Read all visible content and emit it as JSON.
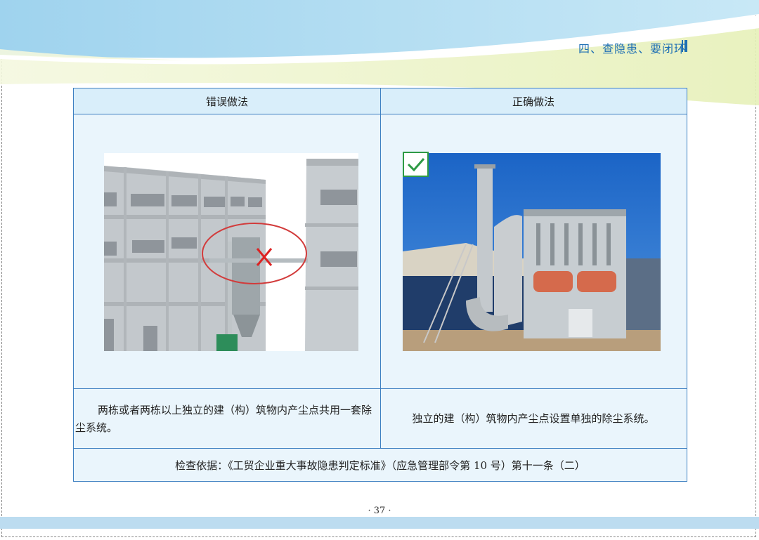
{
  "header": {
    "title": "四、查隐患、要闭环"
  },
  "table": {
    "col_wrong": "错误做法",
    "col_right": "正确做法",
    "wrong_desc": "两栋或者两栋以上独立的建（构）筑物内产尘点共用一套除尘系统。",
    "right_desc": "独立的建（构）筑物内产尘点设置单独的除尘系统。",
    "basis": "检查依据：《工贸企业重大事故隐患判定标准》（应急管理部令第 10 号）第十一条（二）"
  },
  "page_number": "· 37 ·",
  "colors": {
    "accent": "#1e6fb4",
    "border": "#3d7fc1",
    "cell_bg": "#eaf5fc",
    "header_bg": "#d9eefa"
  }
}
